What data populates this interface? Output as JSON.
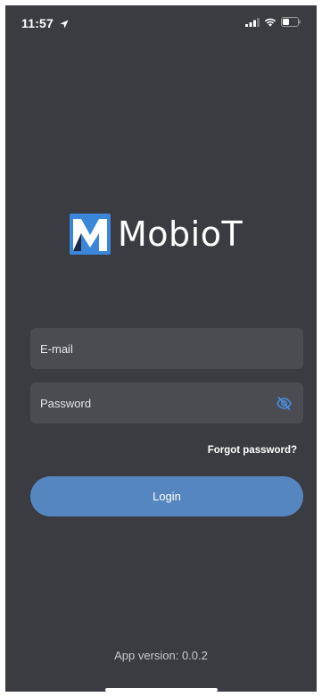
{
  "status_bar": {
    "time": "11:57",
    "icons": [
      "location-arrow-icon",
      "signal-icon",
      "wifi-icon",
      "battery-icon"
    ]
  },
  "logo": {
    "text": "MobioT",
    "mark_letter": "M",
    "colors": {
      "mark_blue": "#3a86d8",
      "mark_dark": "#1e2a44",
      "text": "#ffffff"
    }
  },
  "login_form": {
    "email_placeholder": "E-mail",
    "password_placeholder": "Password",
    "password_toggle_icon": "eye-off-icon",
    "forgot_password_label": "Forgot password?",
    "login_label": "Login"
  },
  "footer": {
    "app_version": "App version: 0.0.2"
  },
  "colors": {
    "background": "#3a3c41",
    "field_background": "#4a4c52",
    "accent": "#5686c0",
    "toggle_icon": "#4a90e2"
  }
}
